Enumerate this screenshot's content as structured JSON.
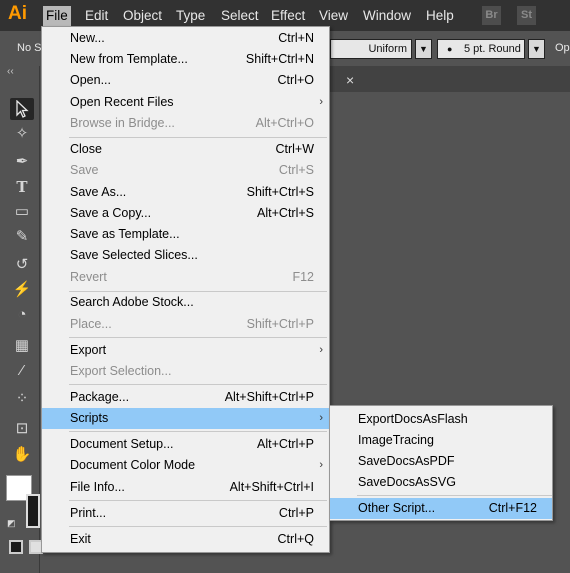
{
  "app": {
    "logo": "Ai"
  },
  "menubar": {
    "items": [
      "File",
      "Edit",
      "Object",
      "Type",
      "Select",
      "Effect",
      "View",
      "Window",
      "Help"
    ],
    "badges": [
      "Br",
      "St"
    ]
  },
  "controlbar": {
    "selection_label": "No Se",
    "stroke_profile": "Uniform",
    "brush": "5 pt. Round",
    "opacity_label": "Op"
  },
  "toolbar": {
    "collapse": "‹‹"
  },
  "document": {
    "close": "×"
  },
  "file_menu": {
    "items": [
      {
        "label": "New...",
        "shortcut": "Ctrl+N"
      },
      {
        "label": "New from Template...",
        "shortcut": "Shift+Ctrl+N"
      },
      {
        "label": "Open...",
        "shortcut": "Ctrl+O"
      },
      {
        "label": "Open Recent Files",
        "shortcut": ""
      },
      {
        "label": "Browse in Bridge...",
        "shortcut": "Alt+Ctrl+O"
      },
      {
        "label": "Close",
        "shortcut": "Ctrl+W"
      },
      {
        "label": "Save",
        "shortcut": "Ctrl+S"
      },
      {
        "label": "Save As...",
        "shortcut": "Shift+Ctrl+S"
      },
      {
        "label": "Save a Copy...",
        "shortcut": "Alt+Ctrl+S"
      },
      {
        "label": "Save as Template...",
        "shortcut": ""
      },
      {
        "label": "Save Selected Slices...",
        "shortcut": ""
      },
      {
        "label": "Revert",
        "shortcut": "F12"
      },
      {
        "label": "Search Adobe Stock...",
        "shortcut": ""
      },
      {
        "label": "Place...",
        "shortcut": "Shift+Ctrl+P"
      },
      {
        "label": "Export",
        "shortcut": ""
      },
      {
        "label": "Export Selection...",
        "shortcut": ""
      },
      {
        "label": "Package...",
        "shortcut": "Alt+Shift+Ctrl+P"
      },
      {
        "label": "Scripts",
        "shortcut": ""
      },
      {
        "label": "Document Setup...",
        "shortcut": "Alt+Ctrl+P"
      },
      {
        "label": "Document Color Mode",
        "shortcut": ""
      },
      {
        "label": "File Info...",
        "shortcut": "Alt+Shift+Ctrl+I"
      },
      {
        "label": "Print...",
        "shortcut": "Ctrl+P"
      },
      {
        "label": "Exit",
        "shortcut": "Ctrl+Q"
      }
    ]
  },
  "scripts_submenu": {
    "items": [
      {
        "label": "ExportDocsAsFlash",
        "shortcut": ""
      },
      {
        "label": "ImageTracing",
        "shortcut": ""
      },
      {
        "label": "SaveDocsAsPDF",
        "shortcut": ""
      },
      {
        "label": "SaveDocsAsSVG",
        "shortcut": ""
      },
      {
        "label": "Other Script...",
        "shortcut": "Ctrl+F12"
      }
    ]
  },
  "colors": {
    "highlight": "#91c9f7",
    "menubar": "#323232",
    "workspace": "#535353",
    "logo": "#ff9a00"
  }
}
